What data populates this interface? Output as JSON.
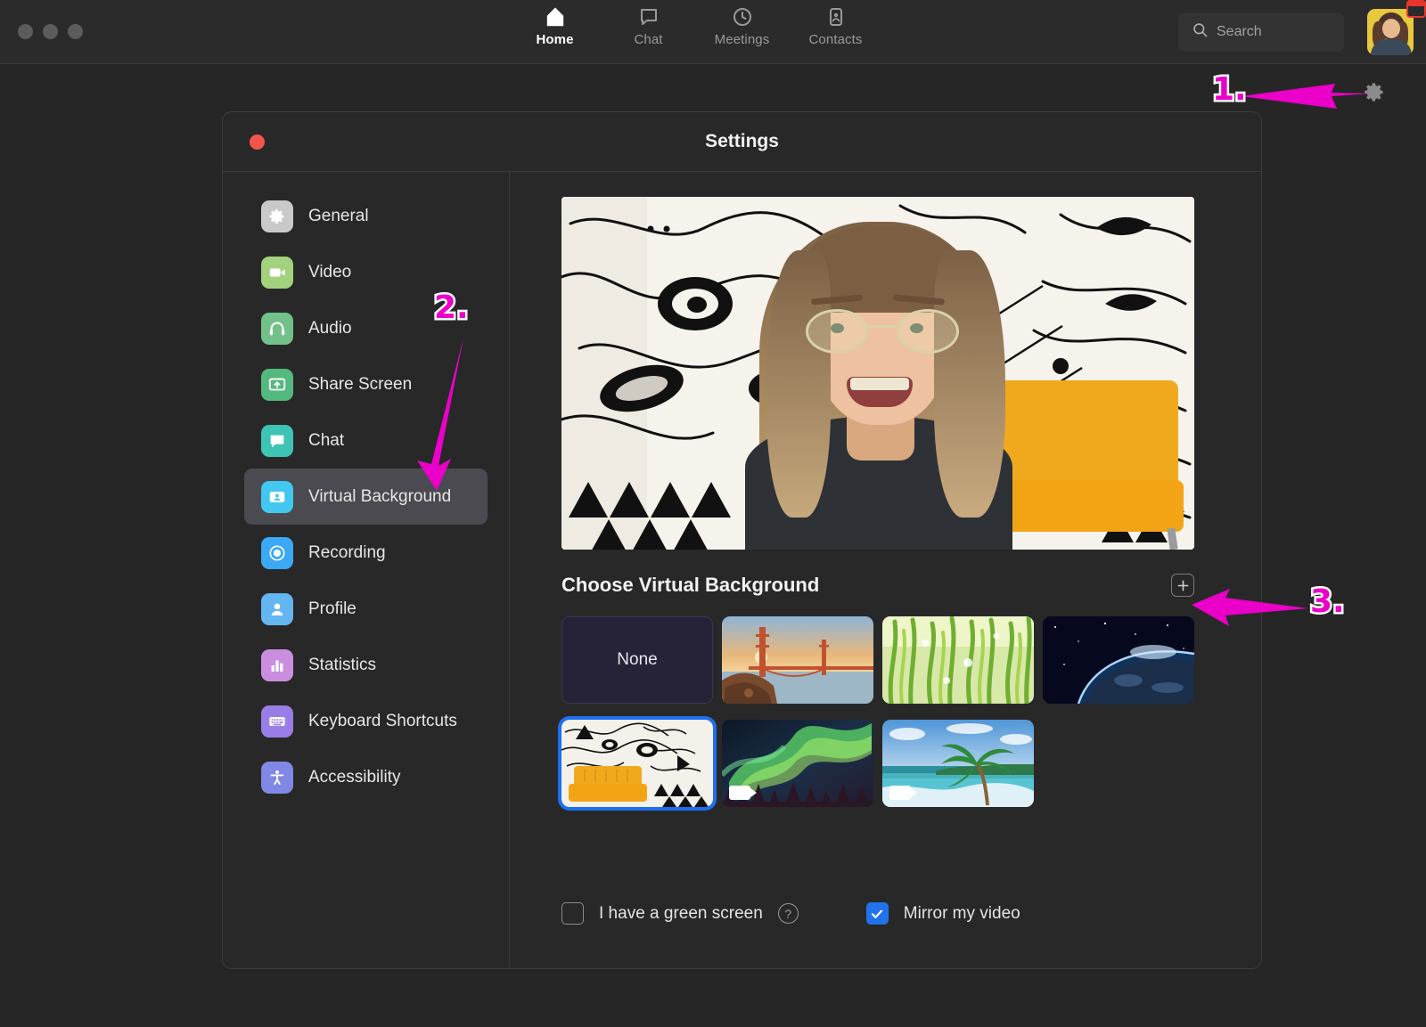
{
  "window": {
    "traffic_lights": [
      "close",
      "minimize",
      "maximize"
    ]
  },
  "nav": {
    "items": [
      {
        "label": "Home",
        "icon": "home-icon",
        "active": true
      },
      {
        "label": "Chat",
        "icon": "chat-bubble-icon",
        "active": false
      },
      {
        "label": "Meetings",
        "icon": "clock-icon",
        "active": false
      },
      {
        "label": "Contacts",
        "icon": "contact-card-icon",
        "active": false
      }
    ],
    "search": {
      "placeholder": "Search",
      "value": "",
      "icon": "search-icon"
    },
    "avatar": {
      "name": "user-avatar",
      "badge": "calendar-badge-icon"
    },
    "gear": {
      "icon": "gear-icon",
      "label": "Settings"
    }
  },
  "annotations": [
    {
      "id": "1",
      "label": "1.",
      "target": "gear-icon",
      "color": "#ea00c8"
    },
    {
      "id": "2",
      "label": "2.",
      "target": "sidebar-item-virtual-background",
      "color": "#ea00c8"
    },
    {
      "id": "3",
      "label": "3.",
      "target": "add-background-button",
      "color": "#ea00c8"
    }
  ],
  "settings": {
    "title": "Settings",
    "close_button": "close-window-button",
    "sidebar": {
      "items": [
        {
          "label": "General",
          "icon": "gear-icon",
          "color": "#c9c9c9",
          "selected": false
        },
        {
          "label": "Video",
          "icon": "video-camera-icon",
          "color": "#a2d27e",
          "selected": false
        },
        {
          "label": "Audio",
          "icon": "headphones-icon",
          "color": "#72c08a",
          "selected": false
        },
        {
          "label": "Share Screen",
          "icon": "share-screen-icon",
          "color": "#54b97e",
          "selected": false
        },
        {
          "label": "Chat",
          "icon": "chat-bubble-icon",
          "color": "#3ec4b4",
          "selected": false
        },
        {
          "label": "Virtual Background",
          "icon": "person-card-icon",
          "color": "#42c8f0",
          "selected": true
        },
        {
          "label": "Recording",
          "icon": "record-icon",
          "color": "#3ba9f5",
          "selected": false
        },
        {
          "label": "Profile",
          "icon": "person-icon",
          "color": "#63b6f0",
          "selected": false
        },
        {
          "label": "Statistics",
          "icon": "bar-chart-icon",
          "color": "#cb8ede",
          "selected": false
        },
        {
          "label": "Keyboard Shortcuts",
          "icon": "keyboard-icon",
          "color": "#9a7ee8",
          "selected": false
        },
        {
          "label": "Accessibility",
          "icon": "accessibility-icon",
          "color": "#8187e4",
          "selected": false
        }
      ]
    },
    "main": {
      "preview": {
        "name": "video-preview",
        "alt": "Live camera preview with virtual background"
      },
      "section_title": "Choose Virtual Background",
      "add_button": {
        "icon": "plus-icon",
        "label": "+"
      },
      "backgrounds": [
        {
          "label": "None",
          "type": "none",
          "selected": false,
          "has_video_badge": false
        },
        {
          "label": "Golden Gate Bridge",
          "type": "image",
          "selected": false,
          "has_video_badge": false
        },
        {
          "label": "Grass",
          "type": "image",
          "selected": false,
          "has_video_badge": false
        },
        {
          "label": "Earth from Space",
          "type": "image",
          "selected": false,
          "has_video_badge": false
        },
        {
          "label": "Illustrated Room with Orange Couch",
          "type": "image",
          "selected": true,
          "has_video_badge": false
        },
        {
          "label": "Aurora Borealis",
          "type": "video",
          "selected": false,
          "has_video_badge": true
        },
        {
          "label": "Tropical Beach",
          "type": "video",
          "selected": false,
          "has_video_badge": true
        }
      ],
      "options": {
        "green_screen": {
          "label": "I have a green screen",
          "checked": false,
          "help_icon": "question-mark-icon",
          "help_label": "?"
        },
        "mirror_video": {
          "label": "Mirror my video",
          "checked": true
        }
      }
    }
  },
  "colors": {
    "accent_blue": "#1d6ff2",
    "annotation_pink": "#ea00c8",
    "window_bg": "#282828",
    "app_bg": "#262626",
    "topbar_bg": "#2b2b2b",
    "selected_sidebar": "#4a4a50"
  }
}
